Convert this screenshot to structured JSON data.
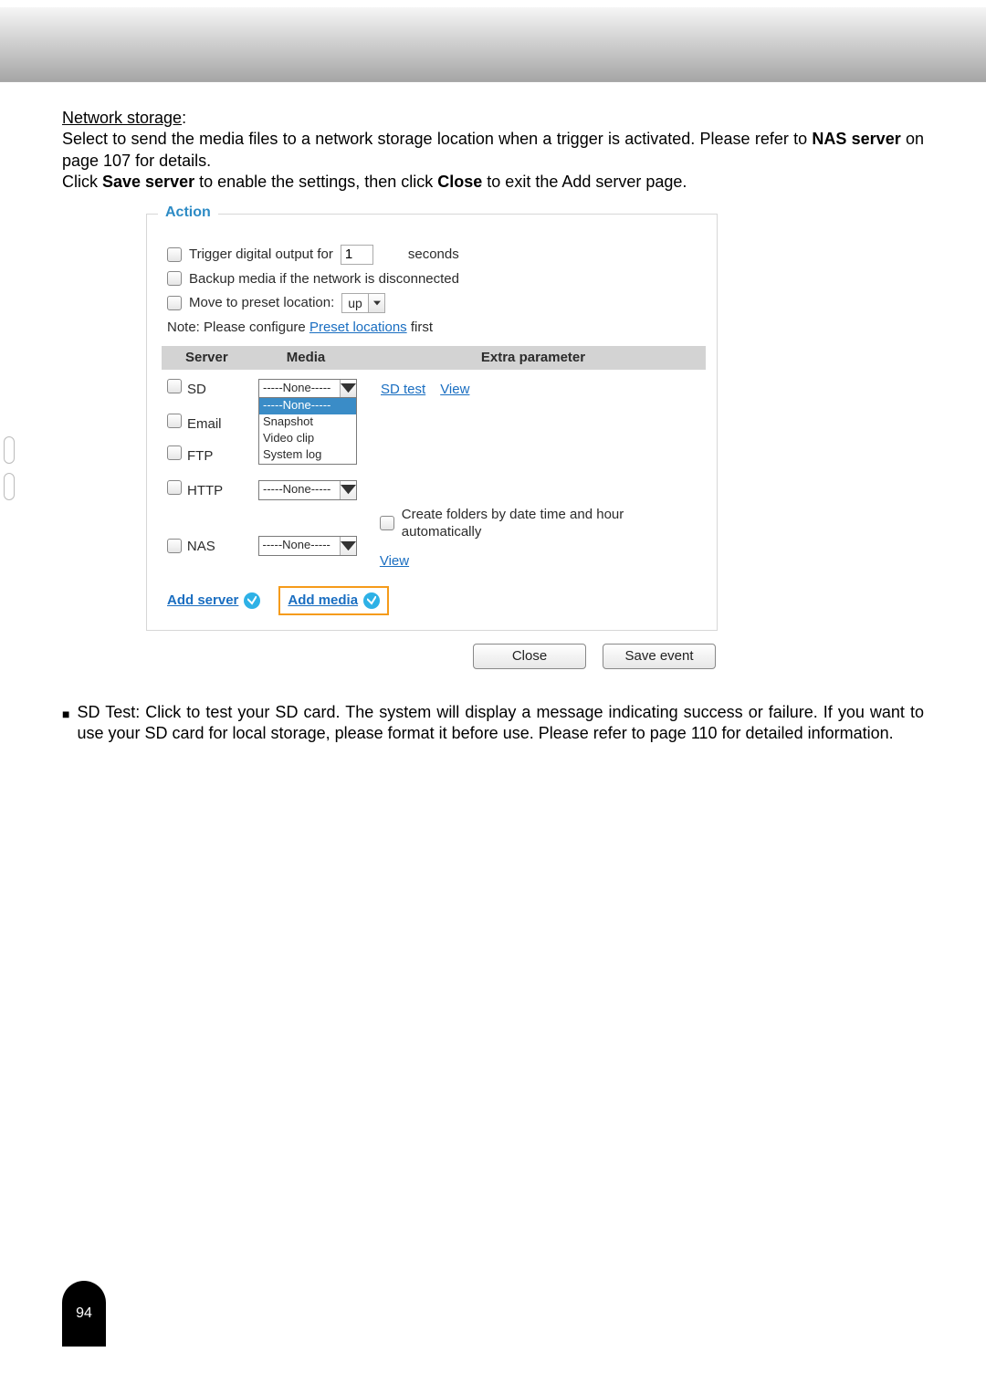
{
  "intro": {
    "heading": "Network storage",
    "colon": ":",
    "line1a": "Select to send the media files to a network storage location when a trigger is activated. Please refer to ",
    "bold1": "NAS server",
    "line1b": " on page 107 for details.",
    "line2a": "Click ",
    "bold2a": "Save server",
    "line2b": " to enable the settings, then click ",
    "bold2c": "Close",
    "line2d": " to exit the Add server page."
  },
  "action": {
    "title": "Action",
    "trigger_a": "Trigger digital output for",
    "trigger_val": "1",
    "trigger_b": "seconds",
    "backup": "Backup media if the network is disconnected",
    "preset_a": "Move to preset location:",
    "preset_val": "up",
    "note_a": "Note: Please configure ",
    "note_link": "Preset locations",
    "note_b": " first",
    "hdr_server": "Server",
    "hdr_media": "Media",
    "hdr_extra": "Extra parameter",
    "rows": {
      "sd": {
        "label": "SD",
        "media": "-----None-----",
        "opts": [
          "-----None-----",
          "Snapshot",
          "Video clip",
          "System log"
        ],
        "extra_a": "SD test",
        "extra_b": "View"
      },
      "email": {
        "label": "Email"
      },
      "ftp": {
        "label": "FTP"
      },
      "http": {
        "label": "HTTP",
        "media": "-----None-----"
      },
      "nas": {
        "label": "NAS",
        "media": "-----None-----",
        "folders": "Create folders by date time and hour automatically",
        "view": "View"
      }
    },
    "add_server": "Add server",
    "add_media": "Add media",
    "close": "Close",
    "save_event": "Save event"
  },
  "after": {
    "text": "SD Test: Click to test your SD card. The system will display a message indicating success or failure. If you want to use your SD card for local storage, please format it before use. Please refer to page 110 for detailed information."
  },
  "page_number": "94"
}
